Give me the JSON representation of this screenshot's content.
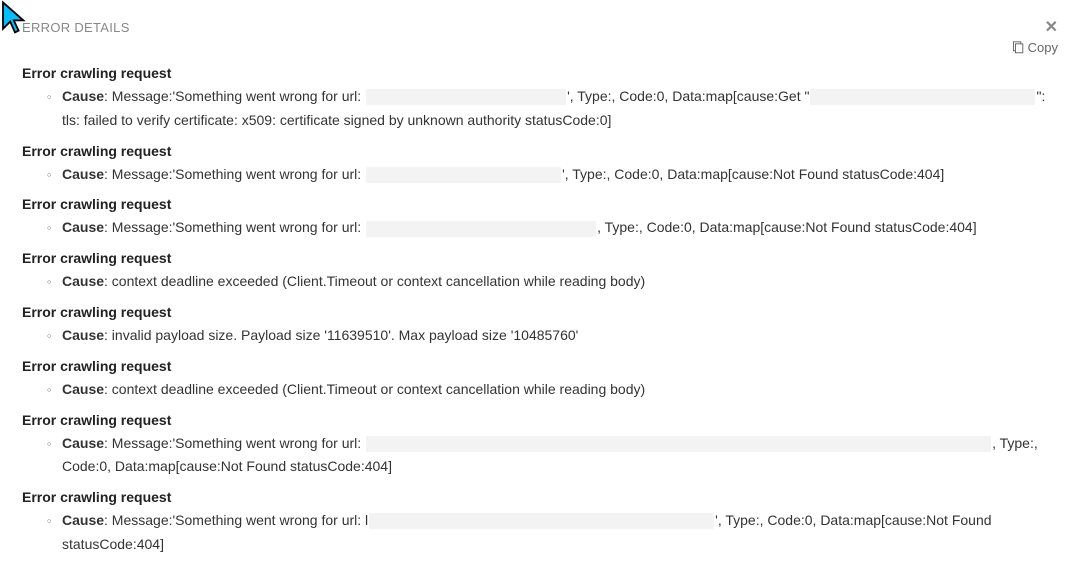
{
  "header": {
    "title": "ERROR DETAILS",
    "copy_label": "Copy"
  },
  "cause_label": "Cause",
  "errors": [
    {
      "title": "Error crawling request",
      "cause_prefix": ": Message:'Something went wrong for url: ",
      "redacted_widths": [
        200,
        225
      ],
      "cause_middle": "', Type:, Code:0, Data:map[cause:Get \"",
      "cause_suffix": "\": tls: failed to verify certificate: x509: certificate signed by unknown authority statusCode:0]"
    },
    {
      "title": "Error crawling request",
      "cause_prefix": ": Message:'Something went wrong for url: ",
      "redacted_widths": [
        195
      ],
      "cause_suffix": "', Type:, Code:0, Data:map[cause:Not Found statusCode:404]"
    },
    {
      "title": "Error crawling request",
      "cause_prefix": ": Message:'Something went wrong for url: ",
      "redacted_widths": [
        230
      ],
      "cause_suffix": ", Type:, Code:0, Data:map[cause:Not Found statusCode:404]"
    },
    {
      "title": "Error crawling request",
      "cause_prefix": ": context deadline exceeded (Client.Timeout or context cancellation while reading body)"
    },
    {
      "title": "Error crawling request",
      "cause_prefix": ": invalid payload size. Payload size '11639510'. Max payload size '10485760'"
    },
    {
      "title": "Error crawling request",
      "cause_prefix": ": context deadline exceeded (Client.Timeout or context cancellation while reading body)"
    },
    {
      "title": "Error crawling request",
      "cause_prefix": ": Message:'Something went wrong for url: ",
      "redacted_widths": [
        625
      ],
      "cause_suffix": ", Type:, Code:0, Data:map[cause:Not Found statusCode:404]"
    },
    {
      "title": "Error crawling request",
      "cause_prefix": ": Message:'Something went wrong for url: l",
      "redacted_widths": [
        345
      ],
      "cause_suffix": "', Type:, Code:0, Data:map[cause:Not Found statusCode:404]"
    }
  ]
}
